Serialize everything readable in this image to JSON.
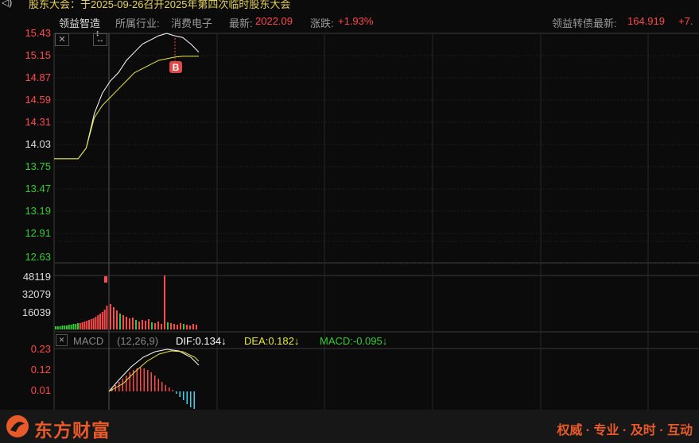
{
  "notice": {
    "icon": "speaker-icon",
    "text": "股东大会：于2025-09-26召开2025年第四次临时股东大会"
  },
  "info": {
    "name": "领益智造",
    "industry_label": "所属行业:",
    "industry": "消费电子",
    "latest_label": "最新:",
    "latest": "2022.09",
    "change_label": "涨跌:",
    "change": "+1.93%",
    "bond_label": "领益转债最新:",
    "bond_price": "164.919",
    "bond_change": "+7."
  },
  "price_axis": [
    "15.43",
    "15.15",
    "14.87",
    "14.59",
    "14.31",
    "14.03",
    "13.75",
    "13.47",
    "13.19",
    "12.91",
    "12.63"
  ],
  "volume_axis": [
    "48119",
    "32079",
    "16039"
  ],
  "macd_axis": [
    "0.23",
    "0.12",
    "0.01"
  ],
  "marker": {
    "label": "B"
  },
  "macd": {
    "title": "MACD",
    "params": "(12,26,9)",
    "dif": "DIF:0.134↓",
    "dea": "DEA:0.182↓",
    "macd": "MACD:-0.095↓"
  },
  "footer": {
    "brand": "东方财富",
    "slogan": "权威 · 专业 · 及时 · 互动"
  },
  "colors": {
    "up": "#ff4a4a",
    "down": "#33cc33",
    "avg_line": "#e8e83a",
    "price_line": "#ffffff",
    "macd_neg": "#3ad4f0",
    "brand": "#e85a2a"
  },
  "chart_data": {
    "type": "line",
    "series": [
      {
        "values": [
          13.9,
          13.9,
          13.9,
          13.9,
          14.03,
          14.45,
          14.7,
          14.85,
          14.95,
          15.1,
          15.2,
          15.3,
          15.35,
          15.4,
          15.43,
          15.4,
          15.38,
          15.3,
          15.2
        ]
      },
      {
        "values": [
          13.9,
          13.9,
          13.9,
          13.9,
          14.03,
          14.4,
          14.55,
          14.65,
          14.75,
          14.85,
          14.95,
          15.0,
          15.05,
          15.1,
          15.12,
          15.14,
          15.15,
          15.15,
          15.15
        ]
      }
    ],
    "ylim": [
      12.63,
      15.43
    ]
  }
}
